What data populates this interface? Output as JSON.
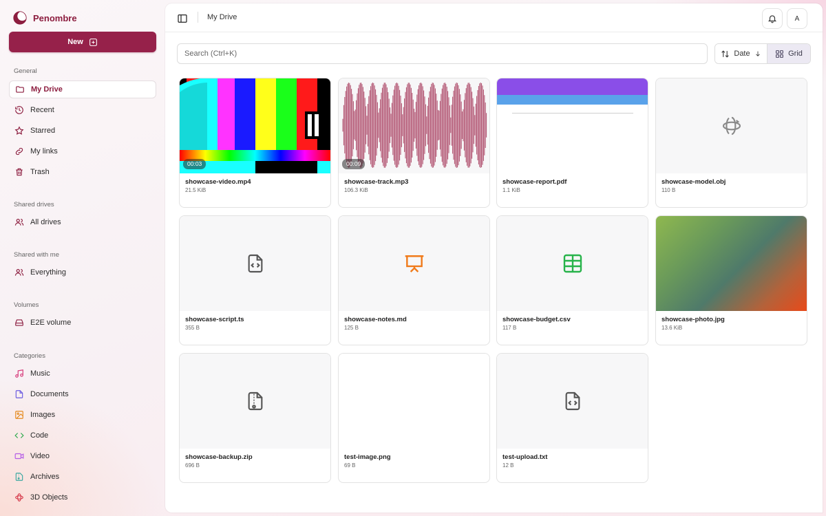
{
  "app": {
    "name": "Penombre"
  },
  "sidebar": {
    "new_label": "New",
    "sections": {
      "general": "General",
      "shared_drives": "Shared drives",
      "shared_with_me": "Shared with me",
      "volumes": "Volumes",
      "categories": "Categories"
    },
    "items": {
      "my_drive": "My Drive",
      "recent": "Recent",
      "starred": "Starred",
      "my_links": "My links",
      "trash": "Trash",
      "all_drives": "All drives",
      "everything": "Everything",
      "e2e_volume": "E2E volume",
      "music": "Music",
      "documents": "Documents",
      "images": "Images",
      "code": "Code",
      "video": "Video",
      "archives": "Archives",
      "objects_3d": "3D Objects"
    },
    "active": "my_drive"
  },
  "header": {
    "title": "My Drive",
    "avatar_initial": "A"
  },
  "toolbar": {
    "search_placeholder": "Search (Ctrl+K)",
    "sort_label": "Date",
    "view_label": "Grid"
  },
  "colors": {
    "brand": "#8c1d3f",
    "new_button": "#96214a",
    "music": "#d63a7a",
    "documents": "#6b5be0",
    "images": "#e58a1e",
    "code": "#2ba84a",
    "video": "#b45be6",
    "archives": "#3aa8a0",
    "objects_3d": "#d63a4a",
    "slides_icon": "#f07a1a",
    "sheet_icon": "#27b34a"
  },
  "files": [
    {
      "name": "showcase-video.mp4",
      "size": "21.5 KiB",
      "duration": "00:03",
      "preview": "video"
    },
    {
      "name": "showcase-track.mp3",
      "size": "106.3 KiB",
      "duration": "00:09",
      "preview": "audio"
    },
    {
      "name": "showcase-report.pdf",
      "size": "1.1 KiB",
      "preview": "pdf"
    },
    {
      "name": "showcase-model.obj",
      "size": "110 B",
      "preview": "3d-icon"
    },
    {
      "name": "showcase-script.ts",
      "size": "355 B",
      "preview": "code-file-icon"
    },
    {
      "name": "showcase-notes.md",
      "size": "125 B",
      "preview": "presentation-icon"
    },
    {
      "name": "showcase-budget.csv",
      "size": "117 B",
      "preview": "sheet-icon"
    },
    {
      "name": "showcase-photo.jpg",
      "size": "13.6 KiB",
      "preview": "photo"
    },
    {
      "name": "showcase-backup.zip",
      "size": "696 B",
      "preview": "archive-file-icon"
    },
    {
      "name": "test-image.png",
      "size": "69 B",
      "preview": "blank"
    },
    {
      "name": "test-upload.txt",
      "size": "12 B",
      "preview": "code-file-icon"
    }
  ]
}
